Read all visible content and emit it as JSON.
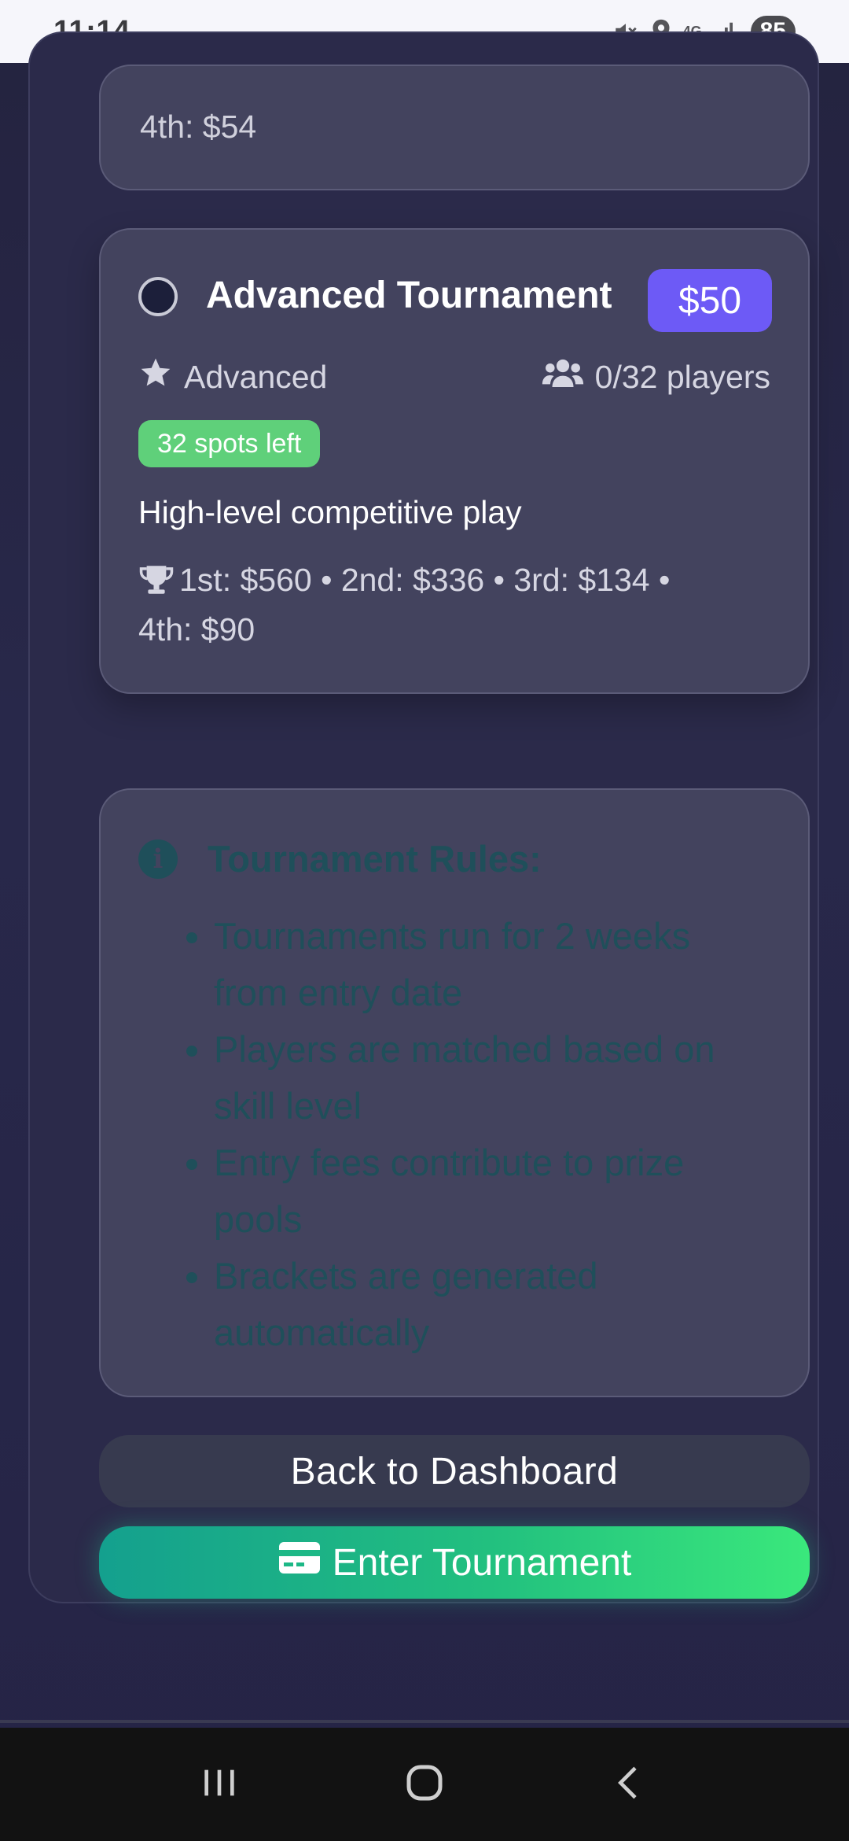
{
  "status_bar": {
    "time": "11:14",
    "network": "4G",
    "battery": "85"
  },
  "previous_card": {
    "prize_line": "4th: $54"
  },
  "tournament": {
    "title": "Advanced Tournament",
    "price": "$50",
    "level": "Advanced",
    "players": "0/32 players",
    "spots_left": "32 spots left",
    "description": "High-level competitive play",
    "prizes_line1": "1st: $560 • 2nd: $336 • 3rd: $134 •",
    "prizes_line2": "4th: $90",
    "selected": false
  },
  "rules": {
    "title": "Tournament Rules:",
    "items": [
      "Tournaments run for 2 weeks from entry date",
      "Players are matched based on skill level",
      "Entry fees contribute to prize pools",
      "Brackets are generated automatically"
    ]
  },
  "buttons": {
    "back": "Back to Dashboard",
    "enter": "Enter Tournament"
  },
  "colors": {
    "accent_price": "#6d5af6",
    "spots_badge": "#5fd07a",
    "enter_gradient_start": "#14a08e",
    "enter_gradient_end": "#3ae87c",
    "rules_text": "#1f4f5a"
  }
}
